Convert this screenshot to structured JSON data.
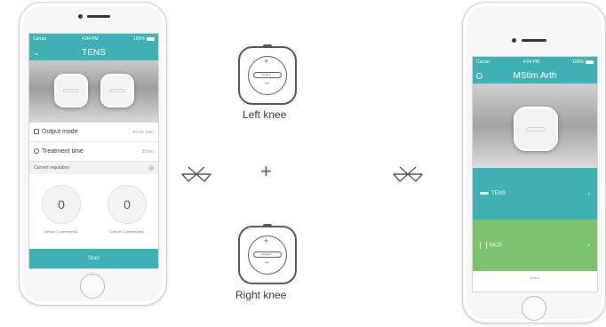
{
  "left_phone": {
    "status": {
      "carrier": "Carrier",
      "time": "4:04 PM",
      "battery": "100%"
    },
    "title": "TENS",
    "rows": [
      {
        "label": "Output mode",
        "value": "Acute pain"
      },
      {
        "label": "Treatment time",
        "value": "30min"
      }
    ],
    "current_regulation_label": "Current regulation",
    "dials": [
      {
        "value": "0",
        "caption": "Device 1 current(mA)"
      },
      {
        "value": "0",
        "caption": "Device 2 current(mA)"
      }
    ],
    "start_label": "Start"
  },
  "middle": {
    "left_knee_label": "Left knee",
    "right_knee_label": "Right knee",
    "plus_label": "+",
    "device_button_label": "Longest"
  },
  "right_phone": {
    "status": {
      "carrier": "Carrier",
      "time": "4:04 PM",
      "battery": "100%"
    },
    "title": "MStim Arth",
    "modes": [
      {
        "label": "TENS"
      },
      {
        "label": "MCR"
      }
    ],
    "about_label": "About"
  },
  "colors": {
    "teal": "#3fb0b4",
    "green": "#7cc26f"
  }
}
